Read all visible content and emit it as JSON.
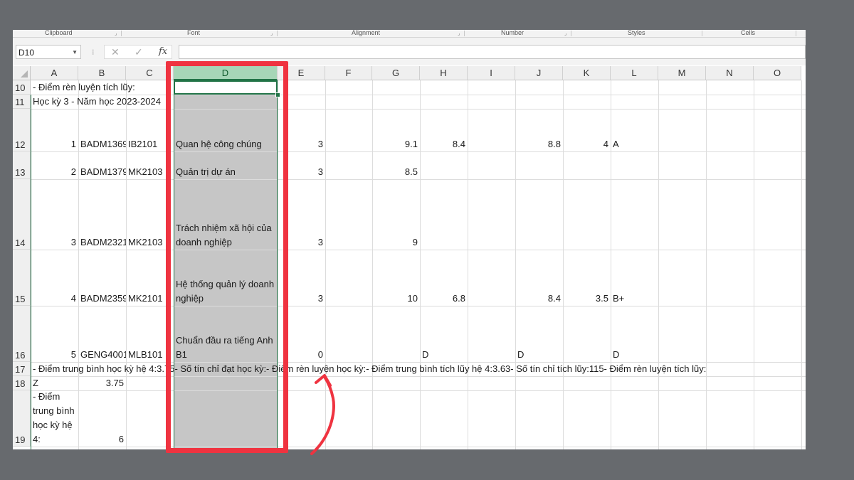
{
  "ribbon": {
    "groups": [
      {
        "label": "Clipboard"
      },
      {
        "label": "Font"
      },
      {
        "label": "Alignment"
      },
      {
        "label": "Number"
      },
      {
        "label": "Styles"
      },
      {
        "label": "Cells"
      }
    ]
  },
  "formula_bar": {
    "name_box": "D10",
    "cancel_icon": "✕",
    "enter_icon": "✓",
    "fx_label": "fx",
    "formula": ""
  },
  "sheet": {
    "selected_column": "D",
    "columns": [
      "A",
      "B",
      "C",
      "D",
      "E",
      "F",
      "G",
      "H",
      "I",
      "J",
      "K",
      "L",
      "M",
      "N",
      "O"
    ],
    "rows": [
      {
        "num": "10",
        "cells": {
          "A": "- Điểm rèn luyện tích lũy:"
        }
      },
      {
        "num": "11",
        "cells": {
          "A": "Học kỳ 3 - Năm học 2023-2024"
        }
      },
      {
        "num": "12",
        "cells": {
          "A": "1",
          "B": "BADM1369",
          "C": "IB2101",
          "D": "Quan hệ công chúng",
          "E": "3",
          "G": "9.1",
          "H": "8.4",
          "J": "8.8",
          "K": "4",
          "L": "A"
        }
      },
      {
        "num": "13",
        "cells": {
          "A": "2",
          "B": "BADM1379",
          "C": "MK2103",
          "D": "Quản trị dự án",
          "E": "3",
          "G": "8.5"
        }
      },
      {
        "num": "14",
        "cells": {
          "A": "3",
          "B": "BADM2321",
          "C": "MK2103",
          "D": "Trách nhiệm xã hội của doanh nghiệp",
          "E": "3",
          "G": "9"
        }
      },
      {
        "num": "15",
        "cells": {
          "A": "4",
          "B": "BADM2359",
          "C": "MK2101",
          "D": "Hệ thống quản lý doanh nghiệp",
          "E": "3",
          "G": "10",
          "H": "6.8",
          "J": "8.4",
          "K": "3.5",
          "L": "B+"
        }
      },
      {
        "num": "16",
        "cells": {
          "A": "5",
          "B": "GENG4001",
          "C": "MLB101",
          "D": "Chuẩn đầu ra tiếng Anh B1",
          "E": "0",
          "H": "D",
          "J": "D",
          "L": "D"
        }
      },
      {
        "num": "17",
        "cells": {
          "A": "- Điểm trung bình học kỳ hệ 4:3.75- Số tín chỉ đạt học kỳ:- Điểm rèn luyện học kỳ:- Điểm trung bình tích lũy hệ 4:3.63- Số tín chỉ tích lũy:115- Điểm rèn luyện tích lũy:"
        }
      },
      {
        "num": "18",
        "cells": {
          "A": "Z",
          "B": "3.75"
        }
      },
      {
        "num": "19",
        "cells": {
          "A": "- Điểm trung bình học kỳ hệ 4:",
          "B": "6"
        }
      }
    ]
  },
  "annotation": {
    "highlight_color": "#ef3340",
    "arrow_icon": "curved-arrow-up"
  }
}
